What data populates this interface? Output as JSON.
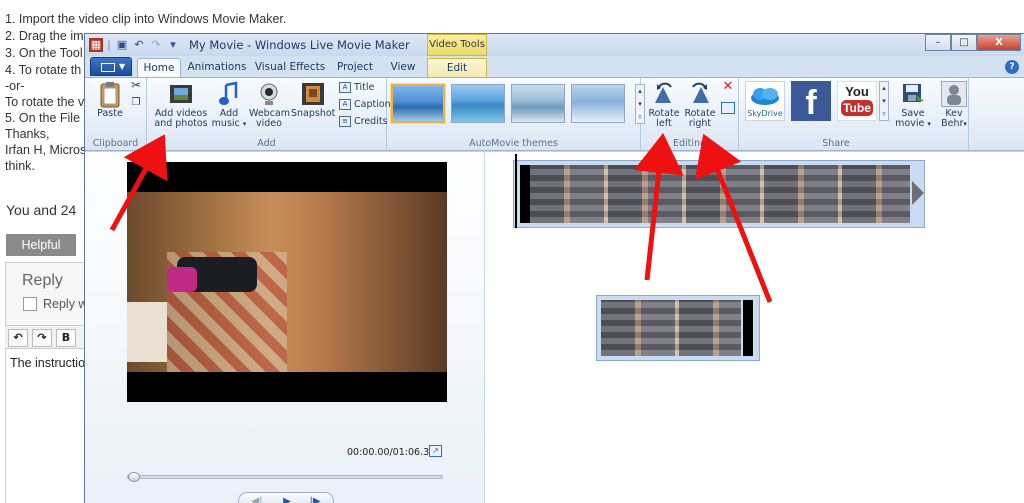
{
  "background_page": {
    "lines": [
      "1. Import the video clip into Windows Movie Maker.",
      "2. Drag the im",
      "3. On the Tool",
      "4. To rotate th",
      "-or-",
      "To rotate the v",
      "5. On the File r",
      "Thanks,",
      "Irfan H, Micros",
      "think."
    ],
    "you_and": "You and 24",
    "helpful_button": "Helpful",
    "reply_title": "Reply",
    "reply_checkbox_label": "Reply w",
    "editor_buttons": [
      "↶",
      "↷",
      "B"
    ],
    "instruction_text": "The instructio"
  },
  "window": {
    "title": "My Movie - Windows Live Movie Maker",
    "context_tab_group": "Video Tools",
    "window_buttons": {
      "minimize": "–",
      "maximize": "□",
      "close": "X"
    }
  },
  "tabs": [
    {
      "label": "Home",
      "active": true
    },
    {
      "label": "Animations"
    },
    {
      "label": "Visual Effects"
    },
    {
      "label": "Project"
    },
    {
      "label": "View"
    },
    {
      "label": "Edit",
      "context": true
    }
  ],
  "help_label": "?",
  "ribbon": {
    "clipboard": {
      "label": "Clipboard",
      "paste": "Paste"
    },
    "add": {
      "label": "Add",
      "add_videos_line1": "Add videos",
      "add_videos_line2": "and photos",
      "add_music_line1": "Add",
      "add_music_line2": "music",
      "webcam_line1": "Webcam",
      "webcam_line2": "video",
      "snapshot": "Snapshot",
      "title": "Title",
      "caption": "Caption",
      "credits": "Credits"
    },
    "themes": {
      "label": "AutoMovie themes"
    },
    "editing": {
      "label": "Editing",
      "rotate_left_line1": "Rotate",
      "rotate_left_line2": "left",
      "rotate_right_line1": "Rotate",
      "rotate_right_line2": "right"
    },
    "share": {
      "label": "Share",
      "skydrive": "SkyDrive",
      "youtube_line1": "You",
      "youtube_line2": "Tube",
      "save_movie_line1": "Save",
      "save_movie_line2": "movie",
      "user_line1": "Kev",
      "user_line2": "Behr"
    }
  },
  "preview": {
    "timecode": "00:00.00/01:06.30",
    "seek_progress": 0.0
  },
  "colors": {
    "arrow_red": "#ee1111",
    "ribbon_blue": "#1e395b",
    "context_yellow": "#eadb6a",
    "facebook_blue": "#3b5998",
    "youtube_red": "#c4302b"
  }
}
